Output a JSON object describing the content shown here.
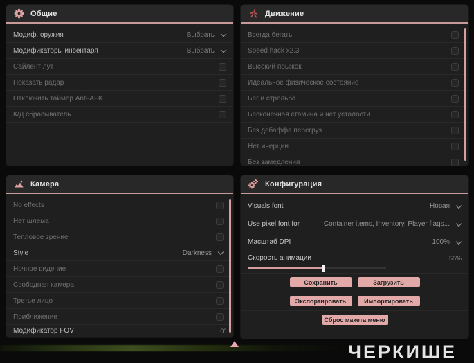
{
  "colors": {
    "accent": "#d7a0a0",
    "panel": "#1f1f1f",
    "button": "#e3a9a9"
  },
  "panels": {
    "general": {
      "title": "Общие",
      "rows": [
        {
          "label": "Модиф. оружия",
          "value": "Выбрать"
        },
        {
          "label": "Модификаторы инвентаря",
          "value": "Выбрать"
        },
        {
          "label": "Сайлент лут"
        },
        {
          "label": "Показать радар"
        },
        {
          "label": "Отключить таймер Anti-AFK"
        },
        {
          "label": "К/Д сбрасыватель"
        }
      ]
    },
    "movement": {
      "title": "Движение",
      "items": [
        "Всегда бегать",
        "Speed hack x2.3",
        "Высокий прыжок",
        "Идеальное физическое состояние",
        "Бег и стрельба",
        "Бесконечная стамина и нет усталости",
        "Без дебаффа перегруз",
        "Нет инерции",
        "Без замедления"
      ]
    },
    "camera": {
      "title": "Камера",
      "rows": [
        {
          "label": "No effects"
        },
        {
          "label": "Нет шлема"
        },
        {
          "label": "Тепловое зрение"
        },
        {
          "label": "Style",
          "value": "Darkness"
        },
        {
          "label": "Ночное видение"
        },
        {
          "label": "Свободная камера"
        },
        {
          "label": "Третье лицо"
        },
        {
          "label": "Приближение"
        },
        {
          "label": "Модификатор FOV",
          "value": "0°",
          "percent": 0
        }
      ]
    },
    "config": {
      "title": "Конфигурация",
      "rows": [
        {
          "label": "Visuals font",
          "value": "Новая"
        },
        {
          "label": "Use pixel font for",
          "value": "Container items, Inventory, Player flags..."
        },
        {
          "label": "Масштаб DPI",
          "value": "100%"
        },
        {
          "label": "Скорость анимации",
          "value": "55%",
          "percent": 55
        }
      ],
      "buttons": [
        "Сохранить",
        "Загрузить",
        "Экспортировать",
        "Импортировать",
        "Сброс макета меню"
      ]
    }
  },
  "watermark": "ЧЕРКИШЕ"
}
